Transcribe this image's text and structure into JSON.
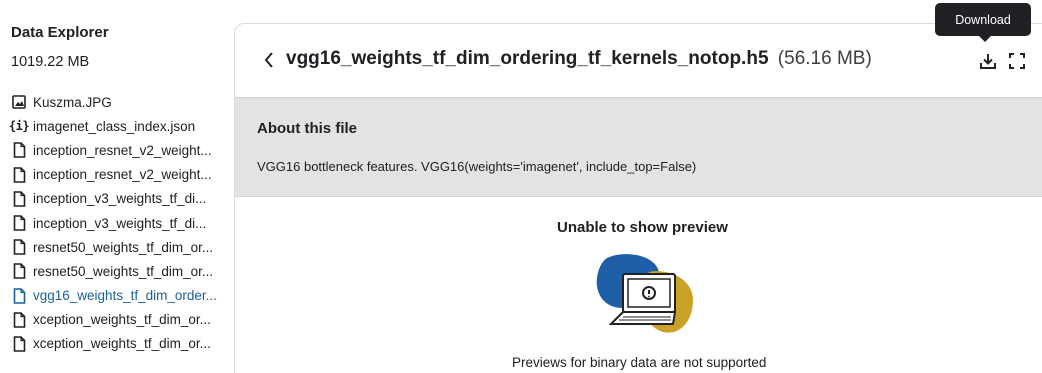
{
  "sidebar": {
    "title": "Data Explorer",
    "size": "1019.22 MB",
    "files": [
      {
        "label": "Kuszma.JPG",
        "icon": "image-icon",
        "active": false
      },
      {
        "label": "imagenet_class_index.json",
        "icon": "json-icon",
        "active": false
      },
      {
        "label": "inception_resnet_v2_weight...",
        "icon": "file-icon",
        "active": false
      },
      {
        "label": "inception_resnet_v2_weight...",
        "icon": "file-icon",
        "active": false
      },
      {
        "label": "inception_v3_weights_tf_di...",
        "icon": "file-icon",
        "active": false
      },
      {
        "label": "inception_v3_weights_tf_di...",
        "icon": "file-icon",
        "active": false
      },
      {
        "label": "resnet50_weights_tf_dim_or...",
        "icon": "file-icon",
        "active": false
      },
      {
        "label": "resnet50_weights_tf_dim_or...",
        "icon": "file-icon",
        "active": false
      },
      {
        "label": "vgg16_weights_tf_dim_order...",
        "icon": "file-icon",
        "active": true
      },
      {
        "label": "xception_weights_tf_dim_or...",
        "icon": "file-icon",
        "active": false
      },
      {
        "label": "xception_weights_tf_dim_or...",
        "icon": "file-icon",
        "active": false
      }
    ]
  },
  "header": {
    "file_name": "vgg16_weights_tf_dim_ordering_tf_kernels_notop.h5",
    "file_size": "(56.16 MB)",
    "tooltip": "Download"
  },
  "about": {
    "title": "About this file",
    "description": "VGG16 bottleneck features. VGG16(weights='imagenet', include_top=False)"
  },
  "preview": {
    "title": "Unable to show preview",
    "message": "Previews for binary data are not supported"
  },
  "colors": {
    "active_link": "#1a5f9e",
    "about_bg": "#e3e3e3",
    "illus_blue": "#1f5fa8",
    "illus_gold": "#c9a227",
    "tooltip_bg": "#202124"
  }
}
